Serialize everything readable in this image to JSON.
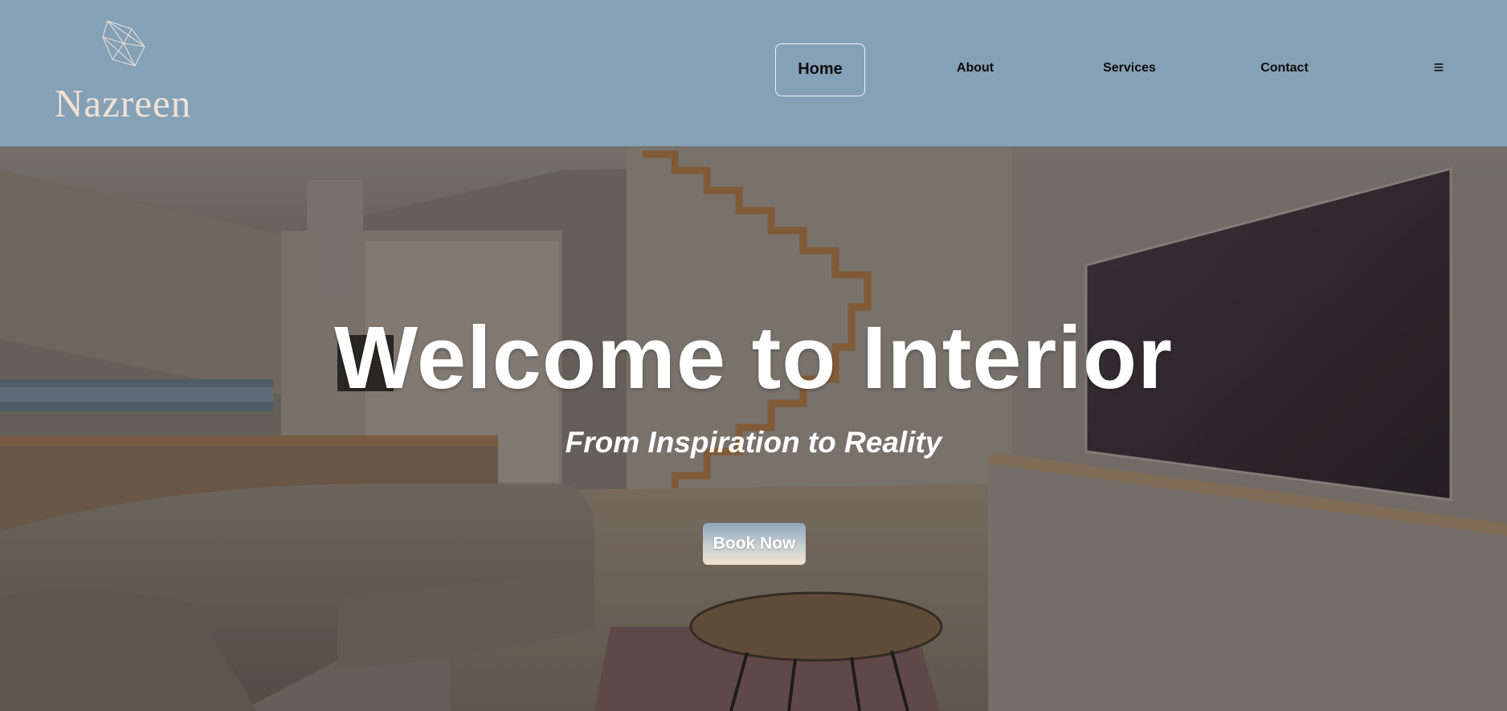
{
  "brand": {
    "name": "Nazreen",
    "logo_icon": "geometric-crystal-icon"
  },
  "nav": {
    "items": [
      {
        "label": "Home",
        "active": true
      },
      {
        "label": "About",
        "active": false
      },
      {
        "label": "Services",
        "active": false
      },
      {
        "label": "Contact",
        "active": false
      }
    ],
    "menu_icon": "≡"
  },
  "hero": {
    "title": "Welcome to Interior",
    "subtitle": "From Inspiration to Reality",
    "cta_label": "Book Now"
  },
  "colors": {
    "header_bg": "#85a1b6",
    "logo_text": "#f1e1d4",
    "nav_text": "#0d0d0d",
    "hero_text": "#ffffff"
  }
}
